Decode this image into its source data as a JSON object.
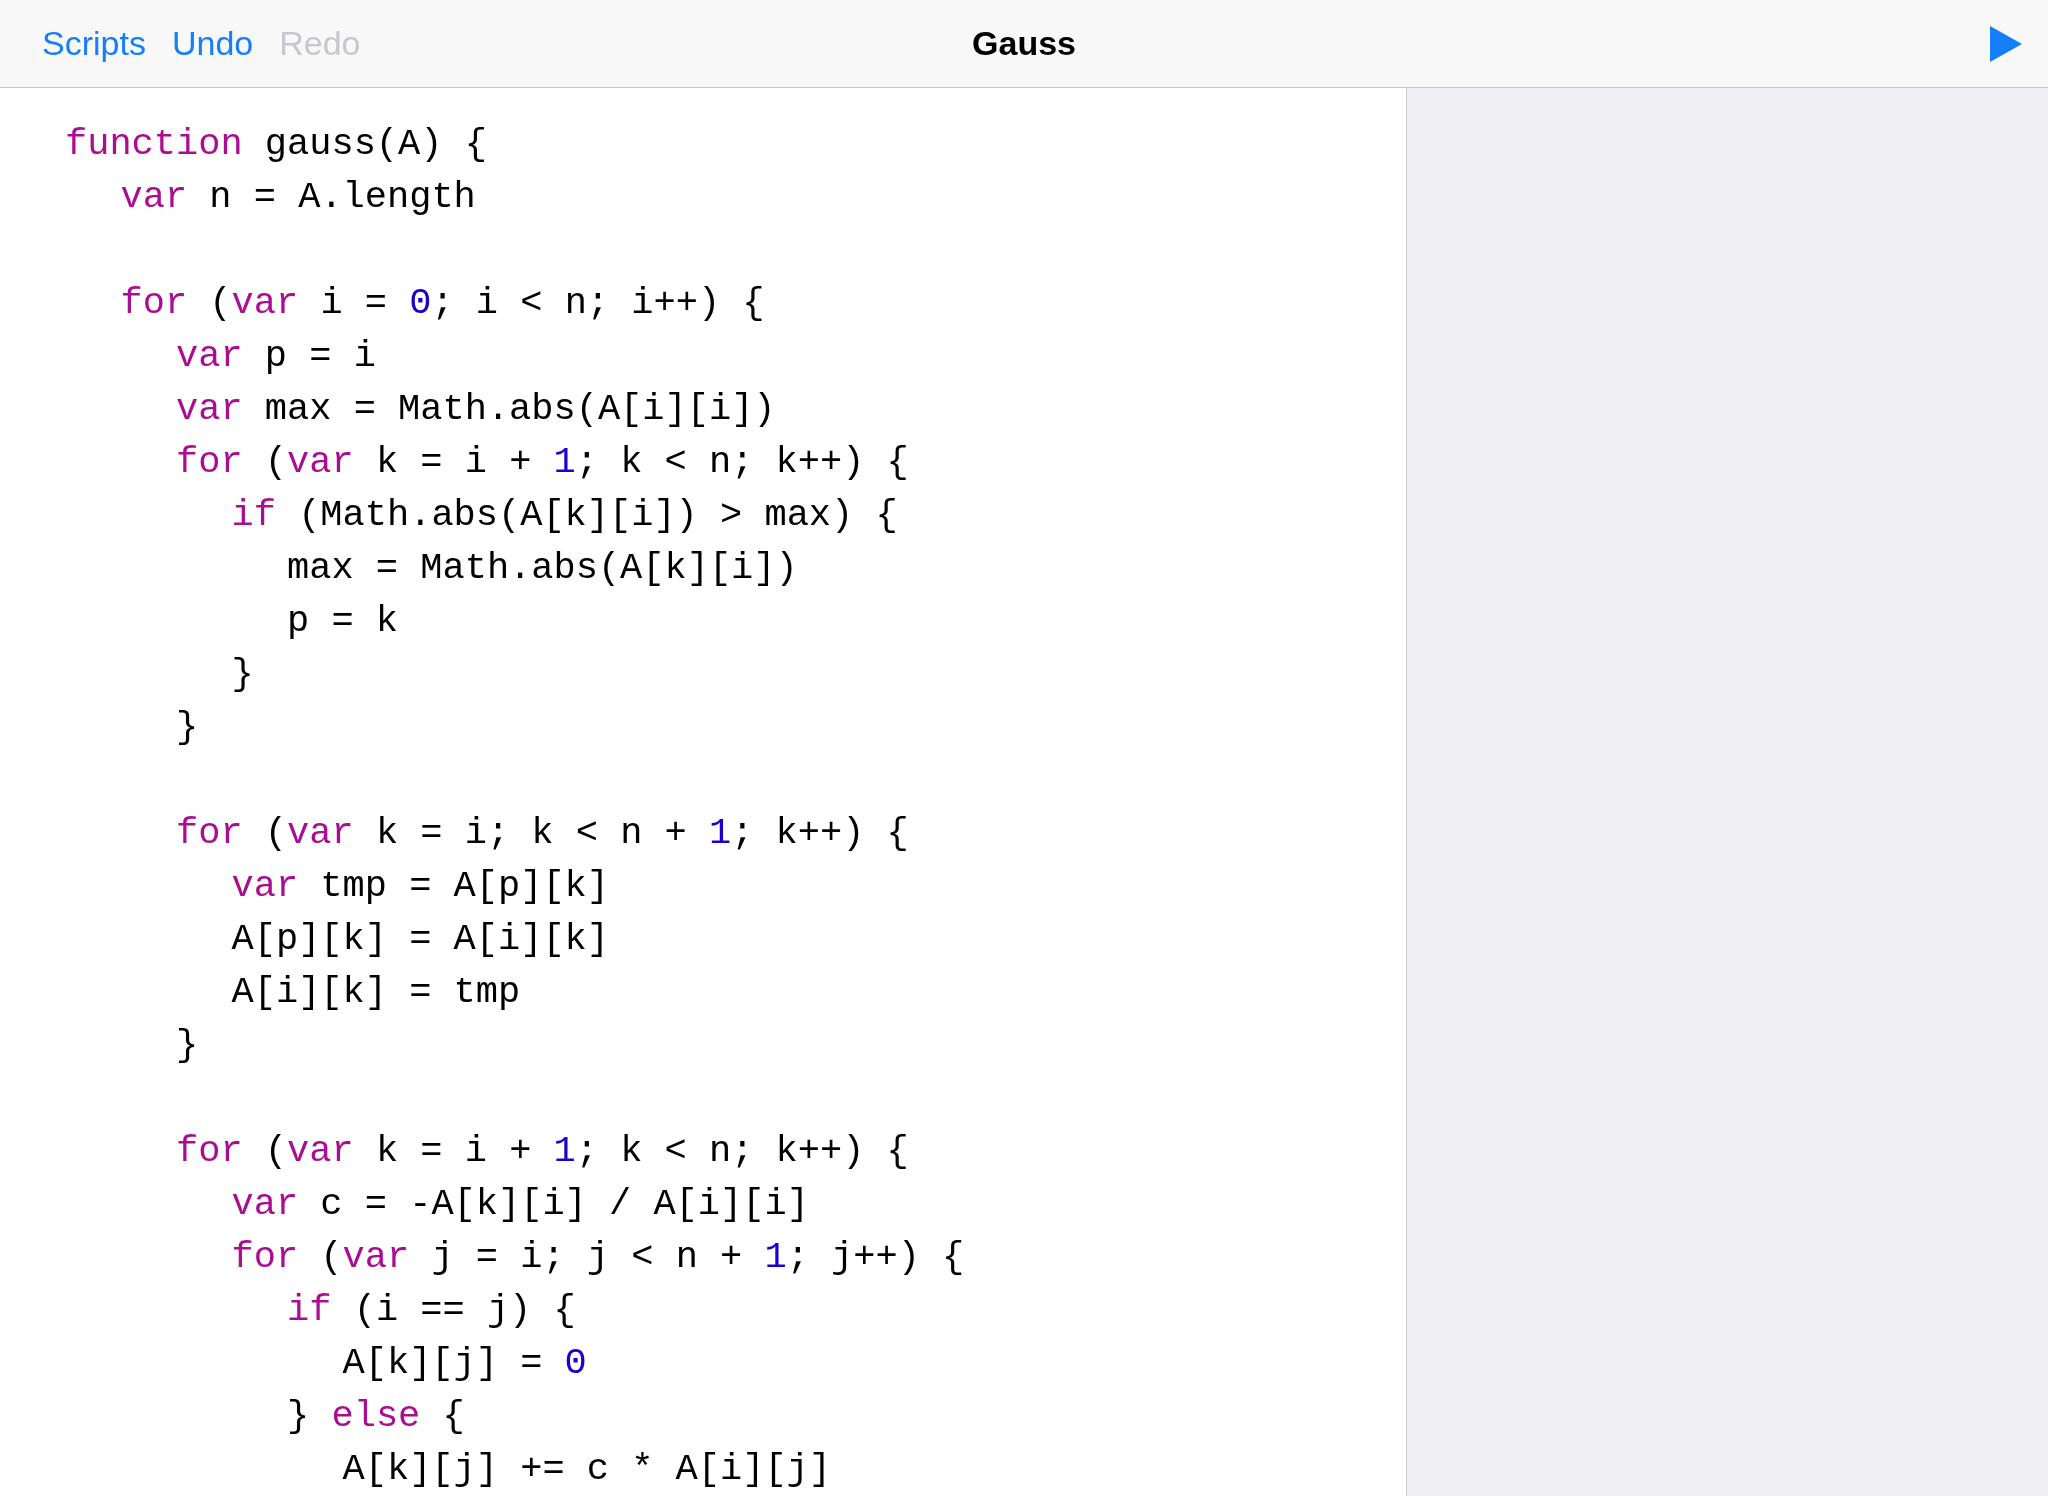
{
  "toolbar": {
    "buttons": [
      {
        "label": "Scripts",
        "disabled": false
      },
      {
        "label": "Undo",
        "disabled": false
      },
      {
        "label": "Redo",
        "disabled": true
      }
    ],
    "title": "Gauss"
  },
  "editor": {
    "lines": [
      {
        "tokens": [
          {
            "kind": "keyword",
            "text": "function"
          },
          {
            "kind": "plain",
            "text": " gauss(A) {"
          }
        ]
      },
      {
        "tokens": [
          {
            "kind": "keyword",
            "text": "\tvar"
          },
          {
            "kind": "plain",
            "text": " n = A.length"
          }
        ]
      },
      {
        "kind": "blank"
      },
      {
        "tokens": [
          {
            "kind": "keyword",
            "text": "\tfor"
          },
          {
            "kind": "plain",
            "text": " ("
          },
          {
            "kind": "keyword",
            "text": "var"
          },
          {
            "kind": "plain",
            "text": " i = "
          },
          {
            "kind": "number",
            "text": "0"
          },
          {
            "kind": "plain",
            "text": "; i < n; i++) {"
          }
        ]
      },
      {
        "tokens": [
          {
            "kind": "keyword",
            "text": "\t\tvar"
          },
          {
            "kind": "plain",
            "text": " p = i"
          }
        ]
      },
      {
        "tokens": [
          {
            "kind": "keyword",
            "text": "\t\tvar"
          },
          {
            "kind": "plain",
            "text": " max = Math.abs(A[i][i])"
          }
        ]
      },
      {
        "tokens": [
          {
            "kind": "keyword",
            "text": "\t\tfor"
          },
          {
            "kind": "plain",
            "text": " ("
          },
          {
            "kind": "keyword",
            "text": "var"
          },
          {
            "kind": "plain",
            "text": " k = i + "
          },
          {
            "kind": "number",
            "text": "1"
          },
          {
            "kind": "plain",
            "text": "; k < n; k++) {"
          }
        ]
      },
      {
        "tokens": [
          {
            "kind": "keyword",
            "text": "\t\t\tif"
          },
          {
            "kind": "plain",
            "text": " (Math.abs(A[k][i]) > max) {"
          }
        ]
      },
      {
        "tokens": [
          {
            "kind": "plain",
            "text": "\t\t\t\tmax = Math.abs(A[k][i])"
          }
        ]
      },
      {
        "tokens": [
          {
            "kind": "plain",
            "text": "\t\t\t\tp = k"
          }
        ]
      },
      {
        "tokens": [
          {
            "kind": "plain",
            "text": "\t\t\t}"
          }
        ]
      },
      {
        "tokens": [
          {
            "kind": "plain",
            "text": "\t\t}"
          }
        ]
      },
      {
        "kind": "blank"
      },
      {
        "tokens": [
          {
            "kind": "keyword",
            "text": "\t\tfor"
          },
          {
            "kind": "plain",
            "text": " ("
          },
          {
            "kind": "keyword",
            "text": "var"
          },
          {
            "kind": "plain",
            "text": " k = i; k < n + "
          },
          {
            "kind": "number",
            "text": "1"
          },
          {
            "kind": "plain",
            "text": "; k++) {"
          }
        ]
      },
      {
        "tokens": [
          {
            "kind": "keyword",
            "text": "\t\t\tvar"
          },
          {
            "kind": "plain",
            "text": " tmp = A[p][k]"
          }
        ]
      },
      {
        "tokens": [
          {
            "kind": "plain",
            "text": "\t\t\tA[p][k] = A[i][k]"
          }
        ]
      },
      {
        "tokens": [
          {
            "kind": "plain",
            "text": "\t\t\tA[i][k] = tmp"
          }
        ]
      },
      {
        "tokens": [
          {
            "kind": "plain",
            "text": "\t\t}"
          }
        ]
      },
      {
        "kind": "blank"
      },
      {
        "tokens": [
          {
            "kind": "keyword",
            "text": "\t\tfor"
          },
          {
            "kind": "plain",
            "text": " ("
          },
          {
            "kind": "keyword",
            "text": "var"
          },
          {
            "kind": "plain",
            "text": " k = i + "
          },
          {
            "kind": "number",
            "text": "1"
          },
          {
            "kind": "plain",
            "text": "; k < n; k++) {"
          }
        ]
      },
      {
        "tokens": [
          {
            "kind": "keyword",
            "text": "\t\t\tvar"
          },
          {
            "kind": "plain",
            "text": " c = -A[k][i] / A[i][i]"
          }
        ]
      },
      {
        "tokens": [
          {
            "kind": "keyword",
            "text": "\t\t\tfor"
          },
          {
            "kind": "plain",
            "text": " ("
          },
          {
            "kind": "keyword",
            "text": "var"
          },
          {
            "kind": "plain",
            "text": " j = i; j < n + "
          },
          {
            "kind": "number",
            "text": "1"
          },
          {
            "kind": "plain",
            "text": "; j++) {"
          }
        ]
      },
      {
        "tokens": [
          {
            "kind": "keyword",
            "text": "\t\t\t\tif"
          },
          {
            "kind": "plain",
            "text": " (i == j) {"
          }
        ]
      },
      {
        "tokens": [
          {
            "kind": "plain",
            "text": "\t\t\t\t\tA[k][j] = "
          },
          {
            "kind": "number",
            "text": "0"
          }
        ]
      },
      {
        "tokens": [
          {
            "kind": "plain",
            "text": "\t\t\t\t} "
          },
          {
            "kind": "keyword",
            "text": "else"
          },
          {
            "kind": "plain",
            "text": " {"
          }
        ]
      },
      {
        "tokens": [
          {
            "kind": "plain",
            "text": "\t\t\t\t\tA[k][j] += c * A[i][j]"
          }
        ]
      }
    ]
  }
}
